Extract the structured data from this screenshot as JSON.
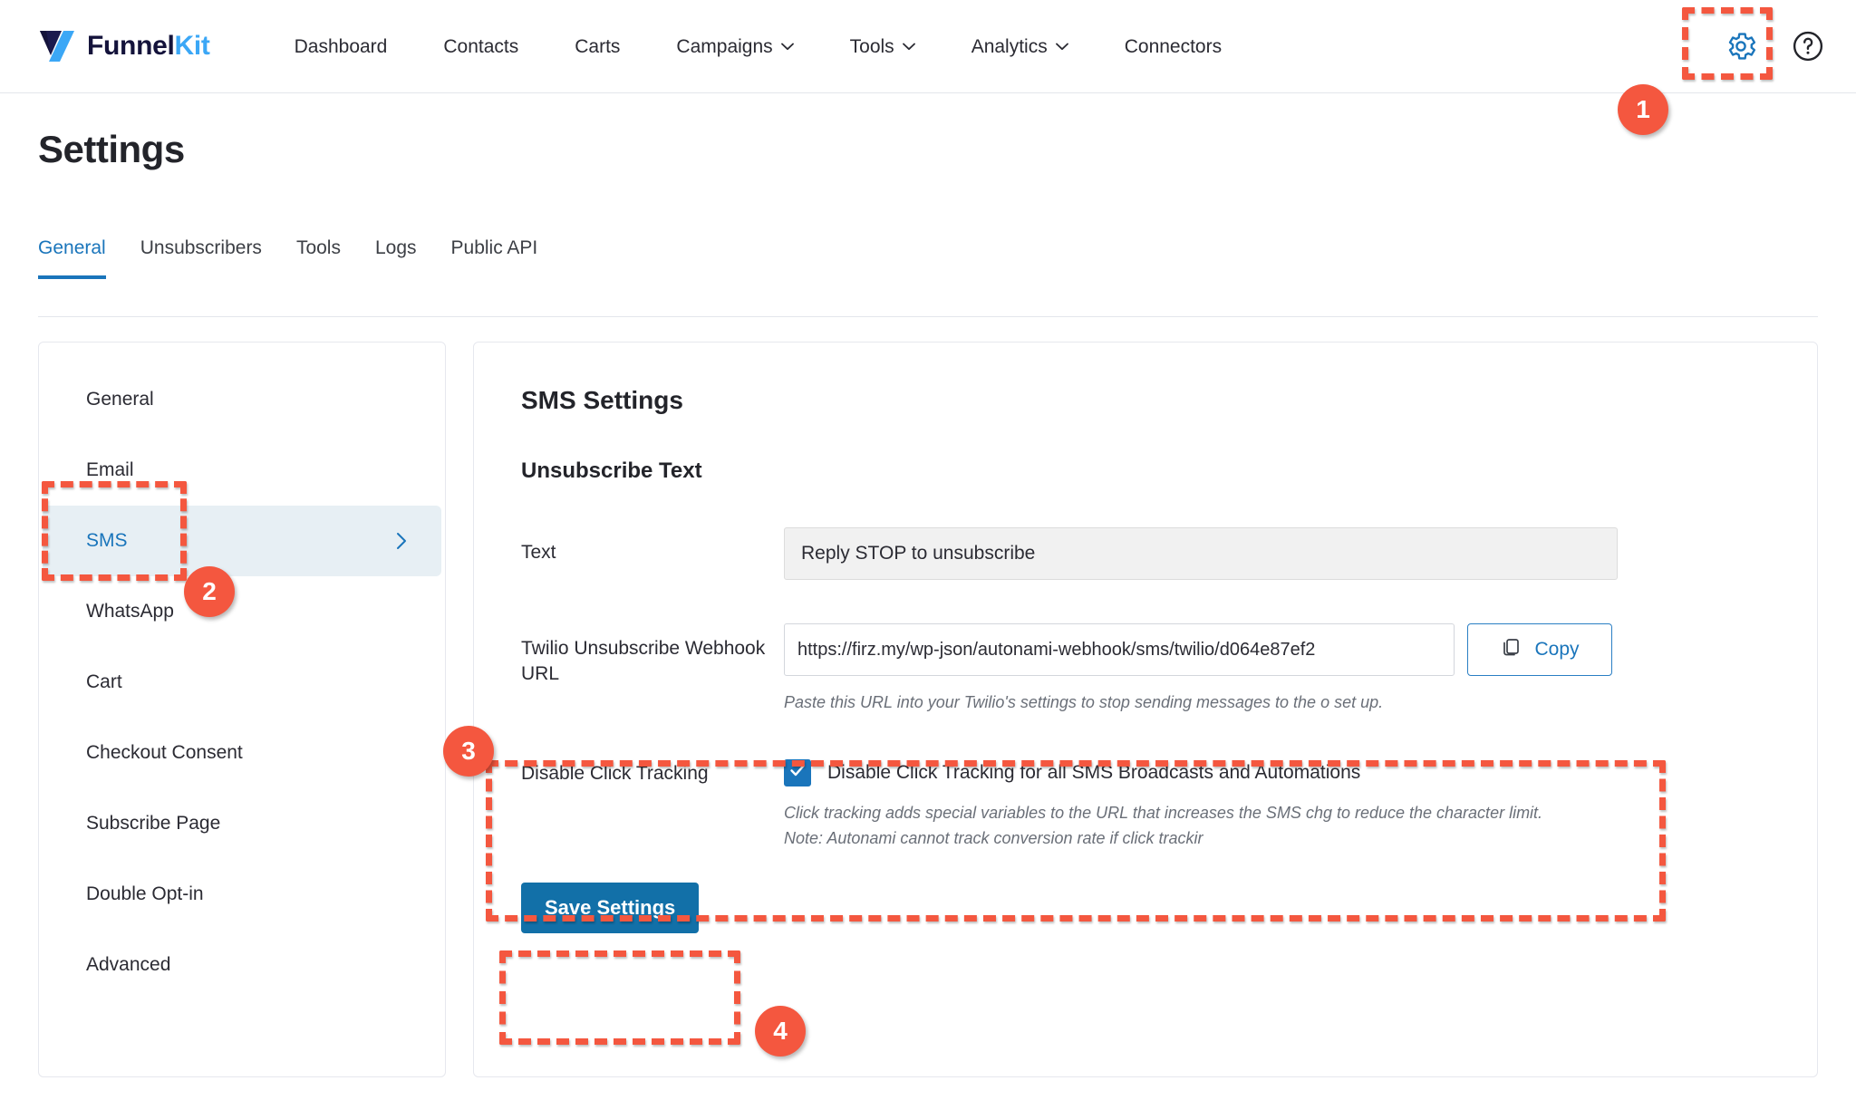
{
  "brand": {
    "name_main": "Funnel",
    "name_accent": "Kit",
    "logo_icon": "funnelkit-logo-icon"
  },
  "topnav": {
    "items": [
      {
        "label": "Dashboard",
        "has_caret": false
      },
      {
        "label": "Contacts",
        "has_caret": false
      },
      {
        "label": "Carts",
        "has_caret": false
      },
      {
        "label": "Campaigns",
        "has_caret": true
      },
      {
        "label": "Tools",
        "has_caret": true
      },
      {
        "label": "Analytics",
        "has_caret": true
      },
      {
        "label": "Connectors",
        "has_caret": false
      }
    ],
    "settings_icon": "gear-icon",
    "help_icon": "question-mark-circle-icon"
  },
  "page": {
    "title": "Settings"
  },
  "tabs": [
    {
      "label": "General",
      "active": true
    },
    {
      "label": "Unsubscribers",
      "active": false
    },
    {
      "label": "Tools",
      "active": false
    },
    {
      "label": "Logs",
      "active": false
    },
    {
      "label": "Public API",
      "active": false
    }
  ],
  "sidebar": {
    "items": [
      {
        "label": "General",
        "active": false,
        "chevron": false
      },
      {
        "label": "Email",
        "active": false,
        "chevron": false
      },
      {
        "label": "SMS",
        "active": true,
        "chevron": true
      },
      {
        "label": "WhatsApp",
        "active": false,
        "chevron": false
      },
      {
        "label": "Cart",
        "active": false,
        "chevron": false
      },
      {
        "label": "Checkout Consent",
        "active": false,
        "chevron": false
      },
      {
        "label": "Subscribe Page",
        "active": false,
        "chevron": false
      },
      {
        "label": "Double Opt-in",
        "active": false,
        "chevron": false
      },
      {
        "label": "Advanced",
        "active": false,
        "chevron": false
      }
    ]
  },
  "main": {
    "heading": "SMS Settings",
    "unsubscribe_section": {
      "heading": "Unsubscribe Text",
      "text_label": "Text",
      "text_value": "Reply STOP to unsubscribe",
      "text_placeholder": "Reply STOP to unsubscribe",
      "webhook_label": "Twilio Unsubscribe Webhook URL",
      "webhook_value": "https://firz.my/wp-json/autonami-webhook/sms/twilio/d064e87ef2",
      "copy_button": "Copy",
      "copy_icon": "copy-icon",
      "webhook_hint": "Paste this URL into your Twilio's settings to stop sending messages to the o set up."
    },
    "click_tracking": {
      "label": "Disable Click Tracking",
      "checkbox_label": "Disable Click Tracking for all SMS Broadcasts and Automations",
      "checked": true,
      "check_icon": "checkmark-icon",
      "hint": "Click tracking adds special variables to the URL that increases the SMS chg to reduce the character limit. Note: Autonami cannot track conversion rate if click trackir"
    },
    "save_button": "Save Settings"
  },
  "annotations": {
    "accent_color": "#f4573f",
    "steps": [
      {
        "number": "1",
        "target": "settings-gear-icon"
      },
      {
        "number": "2",
        "target": "sidebar-item-sms"
      },
      {
        "number": "3",
        "target": "disable-click-tracking-section"
      },
      {
        "number": "4",
        "target": "save-settings-button"
      }
    ]
  },
  "colors": {
    "brand_navy": "#14133b",
    "brand_blue": "#3ba7f6",
    "link_blue": "#1a75bb",
    "button_blue": "#1270a8",
    "annotation_red": "#f4573f",
    "active_row_bg": "#e7eff4"
  }
}
